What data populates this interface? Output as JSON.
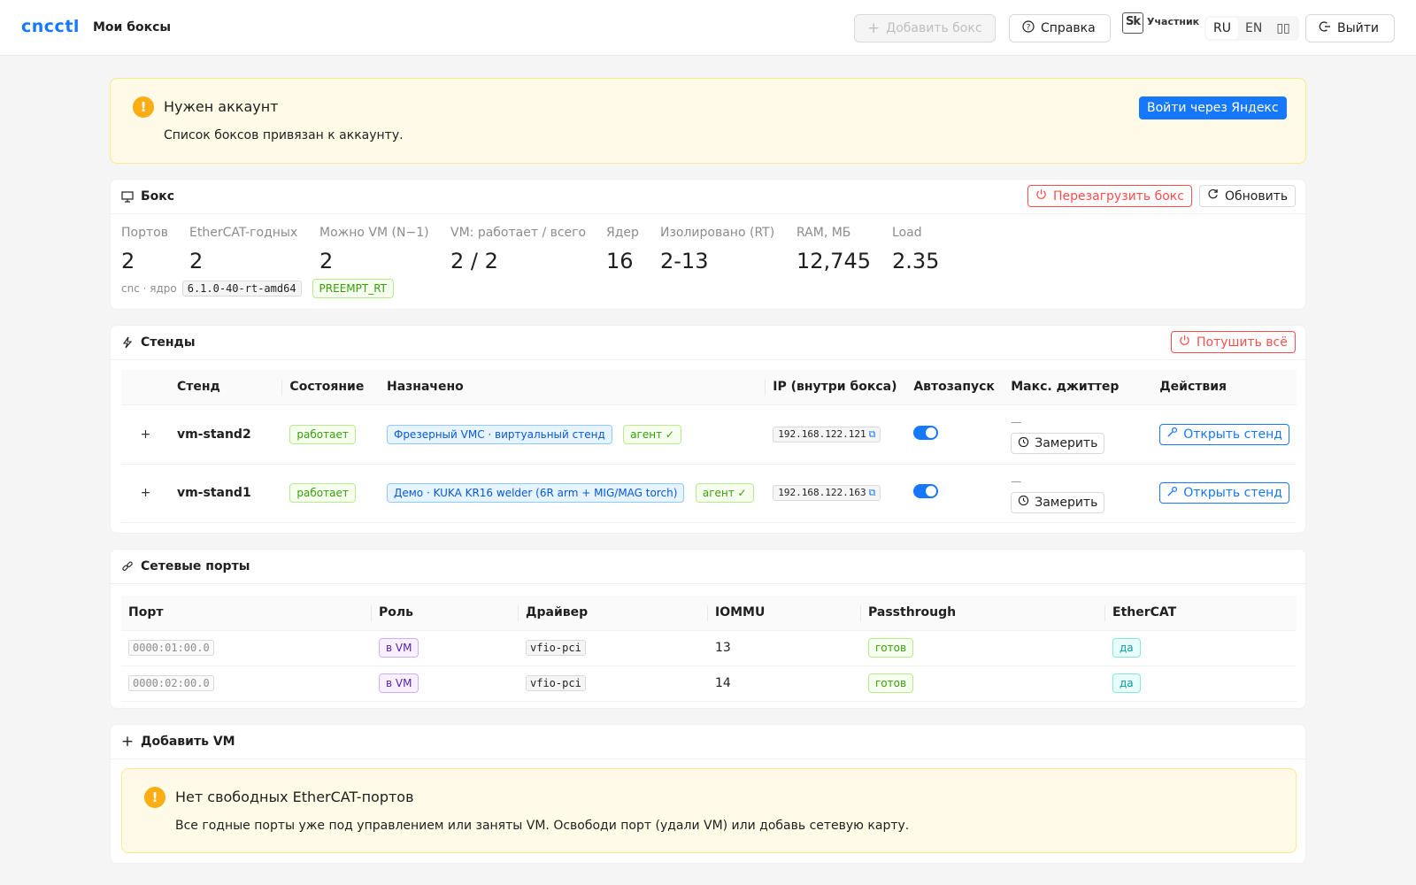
{
  "header": {
    "logo": "cncctl",
    "nav_title": "Мои боксы",
    "add_box_label": "Добавить бокс",
    "help_label": "Справка",
    "participant_badge": {
      "mark": "Sk",
      "label": "Участник"
    },
    "languages": [
      "RU",
      "EN",
      "▯▯"
    ],
    "logout_label": "Выйти"
  },
  "account_alert": {
    "title": "Нужен аккаунт",
    "description": "Список боксов привязан к аккаунту.",
    "login_button": "Войти через Яндекс"
  },
  "box": {
    "title": "Бокс",
    "reboot_label": "Перезагрузить бокс",
    "refresh_label": "Обновить",
    "stats": [
      {
        "label": "Портов",
        "value": "2"
      },
      {
        "label": "EtherCAT-годных",
        "value": "2"
      },
      {
        "label": "Можно VM (N−1)",
        "value": "2"
      },
      {
        "label": "VM: работает / всего",
        "value": "2 / 2"
      },
      {
        "label": "Ядер",
        "value": "16"
      },
      {
        "label": "Изолировано (RT)",
        "value": "2-13"
      },
      {
        "label": "RAM, МБ",
        "value": "12,745"
      },
      {
        "label": "Load",
        "value": "2.35"
      }
    ],
    "kernel_prefix": "cnc · ядро",
    "kernel_version": "6.1.0-40-rt-amd64",
    "kernel_tag": "PREEMPT_RT"
  },
  "stands": {
    "title": "Стенды",
    "shutdown_all_label": "Потушить всё",
    "columns": [
      "Стенд",
      "Состояние",
      "Назначено",
      "IP (внутри бокса)",
      "Автозапуск",
      "Макс. джиттер",
      "Действия"
    ],
    "rows": [
      {
        "name": "vm-stand2",
        "state": "работает",
        "assigned": "Фрезерный VMC · виртуальный стенд",
        "agent": "агент ✓",
        "ip": "192.168.122.121",
        "autostart": true,
        "jitter": "—",
        "measure_label": "Замерить",
        "open_label": "Открыть стенд"
      },
      {
        "name": "vm-stand1",
        "state": "работает",
        "assigned": "Демо · KUKA KR16 welder (6R arm + MIG/MAG torch)",
        "agent": "агент ✓",
        "ip": "192.168.122.163",
        "autostart": true,
        "jitter": "—",
        "measure_label": "Замерить",
        "open_label": "Открыть стенд"
      }
    ]
  },
  "ports": {
    "title": "Сетевые порты",
    "columns": [
      "Порт",
      "Роль",
      "Драйвер",
      "IOMMU",
      "Passthrough",
      "EtherCAT"
    ],
    "rows": [
      {
        "port": "0000:01:00.0",
        "role": "в VM",
        "driver": "vfio-pci",
        "iommu": "13",
        "passthrough": "готов",
        "ethercat": "да"
      },
      {
        "port": "0000:02:00.0",
        "role": "в VM",
        "driver": "vfio-pci",
        "iommu": "14",
        "passthrough": "готов",
        "ethercat": "да"
      }
    ]
  },
  "add_vm": {
    "title": "Добавить VM",
    "alert_title": "Нет свободных EtherCAT-портов",
    "alert_description": "Все годные порты уже под управлением или заняты VM. Освободи порт (удали VM) или добавь сетевую карту."
  },
  "colors": {
    "primary": "#1677ff",
    "danger": "#ff4d4f",
    "warning": "#faad14",
    "success": "#389e0d"
  }
}
